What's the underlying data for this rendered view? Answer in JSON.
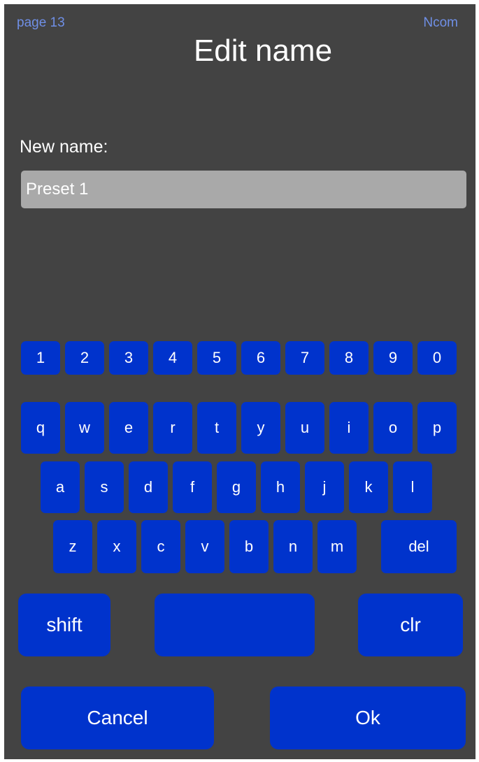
{
  "header": {
    "page": "page 13",
    "brand": "Ncom",
    "title": "Edit name"
  },
  "form": {
    "label": "New name:",
    "value": "Preset 1"
  },
  "keyboard": {
    "row1": [
      "1",
      "2",
      "3",
      "4",
      "5",
      "6",
      "7",
      "8",
      "9",
      "0"
    ],
    "row2": [
      "q",
      "w",
      "e",
      "r",
      "t",
      "y",
      "u",
      "i",
      "o",
      "p"
    ],
    "row3": [
      "a",
      "s",
      "d",
      "f",
      "g",
      "h",
      "j",
      "k",
      "l"
    ],
    "row4": [
      "z",
      "x",
      "c",
      "v",
      "b",
      "n",
      "m"
    ],
    "del": "del",
    "shift": "shift",
    "space": "",
    "clr": "clr"
  },
  "actions": {
    "cancel": "Cancel",
    "ok": "Ok"
  },
  "colors": {
    "background": "#434343",
    "key": "#0033cc",
    "input": "#a9a9a9",
    "header_text": "#6f8fe6"
  }
}
